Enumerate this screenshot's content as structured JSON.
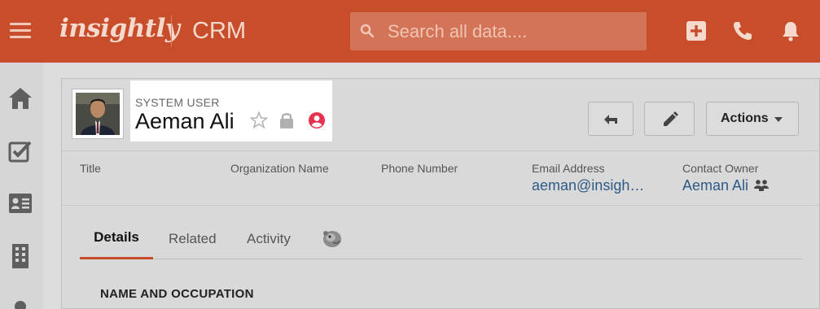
{
  "topbar": {
    "logo": "insightly",
    "app_name": "CRM",
    "search_placeholder": "Search all data...."
  },
  "record": {
    "type_label": "SYSTEM USER",
    "name": "Aeman Ali"
  },
  "actions": {
    "actions_label": "Actions"
  },
  "fields": [
    {
      "label": "Title",
      "value": ""
    },
    {
      "label": "Organization Name",
      "value": ""
    },
    {
      "label": "Phone Number",
      "value": ""
    },
    {
      "label": "Email Address",
      "value": "aeman@insigh…"
    },
    {
      "label": "Contact Owner",
      "value": "Aeman Ali"
    }
  ],
  "tabs": [
    {
      "label": "Details",
      "active": true
    },
    {
      "label": "Related",
      "active": false
    },
    {
      "label": "Activity",
      "active": false
    }
  ],
  "section": {
    "title": "NAME AND OCCUPATION"
  },
  "colors": {
    "brand": "#c84d2a",
    "link": "#2d5a86",
    "badge": "#e8314f"
  }
}
